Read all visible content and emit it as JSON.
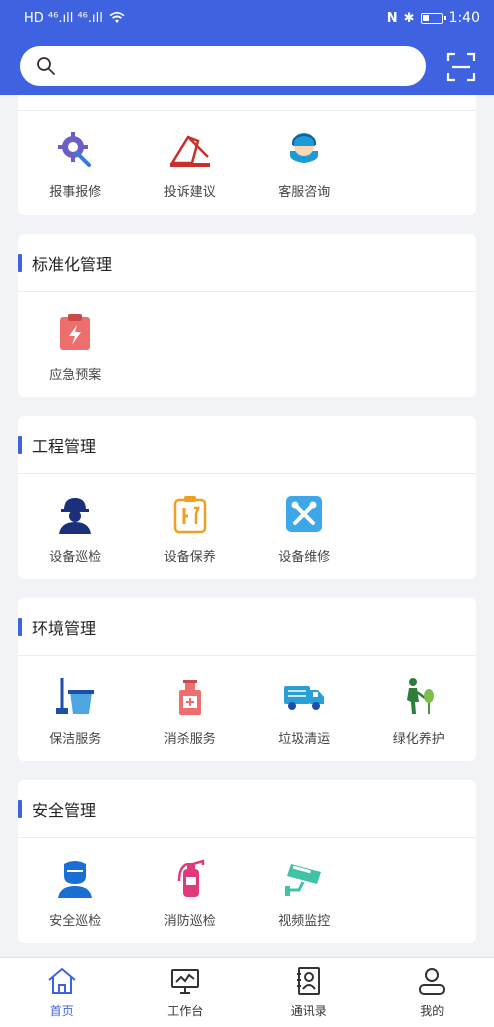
{
  "status_bar": {
    "left": "HD ⁴⁶.ıll ⁴⁶.ıll",
    "time": "1:40"
  },
  "search": {
    "placeholder": ""
  },
  "sections": [
    {
      "title": "",
      "items": [
        {
          "label": "报事报修",
          "icon": "gear-wrench-icon"
        },
        {
          "label": "投诉建议",
          "icon": "envelope-icon"
        },
        {
          "label": "客服咨询",
          "icon": "headset-icon"
        }
      ]
    },
    {
      "title": "标准化管理",
      "items": [
        {
          "label": "应急预案",
          "icon": "clipboard-lightning-icon"
        }
      ]
    },
    {
      "title": "工程管理",
      "items": [
        {
          "label": "设备巡检",
          "icon": "worker-icon"
        },
        {
          "label": "设备保养",
          "icon": "maintenance-icon"
        },
        {
          "label": "设备维修",
          "icon": "tools-icon"
        }
      ]
    },
    {
      "title": "环境管理",
      "items": [
        {
          "label": "保洁服务",
          "icon": "mop-bucket-icon"
        },
        {
          "label": "消杀服务",
          "icon": "sanitizer-icon"
        },
        {
          "label": "垃圾清运",
          "icon": "garbage-truck-icon"
        },
        {
          "label": "绿化养护",
          "icon": "gardener-icon"
        }
      ]
    },
    {
      "title": "安全管理",
      "items": [
        {
          "label": "安全巡检",
          "icon": "guard-icon"
        },
        {
          "label": "消防巡检",
          "icon": "fire-extinguisher-icon"
        },
        {
          "label": "视频监控",
          "icon": "cctv-camera-icon"
        }
      ]
    }
  ],
  "tabs": [
    {
      "label": "首页",
      "active": true
    },
    {
      "label": "工作台",
      "active": false
    },
    {
      "label": "通讯录",
      "active": false
    },
    {
      "label": "我的",
      "active": false
    }
  ],
  "colors": {
    "primary": "#3f63e0",
    "background": "#f2f3f6"
  }
}
